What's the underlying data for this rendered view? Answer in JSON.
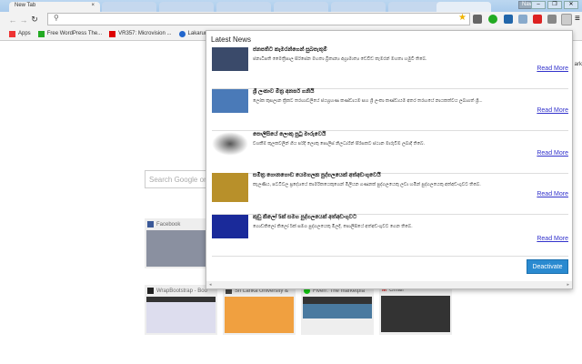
{
  "browser": {
    "active_tab": "New Tab",
    "tab_close": "×",
    "user": "Navodh",
    "win_buttons": [
      "–",
      "❐",
      "✕"
    ],
    "omnibox_value": "",
    "search_icon": "⚲"
  },
  "bookmarks": [
    {
      "label": "Apps",
      "color": "#e33"
    },
    {
      "label": "Free WordPress The...",
      "color": "#2a2"
    },
    {
      "label": "VR357: Microvision ...",
      "color": "#d00"
    },
    {
      "label": "Lakaruna",
      "color": "#26c"
    }
  ],
  "newtab": {
    "search_placeholder": "Search Google or",
    "tiles": [
      {
        "label": "Facebook"
      },
      {
        "label": "WrapBootstrap - Boo"
      },
      {
        "label": "Sri Lanka University &"
      },
      {
        "label": "Fiverr: The marketpla"
      },
      {
        "label": "Gmail"
      }
    ]
  },
  "popup": {
    "heading": "Latest News",
    "read_more": "Read More",
    "deactivate": "Deactivate",
    "partial_right": "ark",
    "items": [
      {
        "title": "ජනපතිට කැමරන්ගෙන් සුබපැතුම්",
        "desc": "ජනාධිපති මෛත්‍රීපාල සිරිසේන මහතා බ්‍රිතාන්‍ය අග්‍රාමාත්‍ය ඩේවිඩ් කැමරන් මහතා හමුවී තිබේ.",
        "color": "#3a4a6a"
      },
      {
        "title": "ශ්‍රී ලංකාව මිත්‍ර අනර්ඝ ගනියි",
        "desc": "ලෝක කුසලාන ක්‍රිකට් තරඟාවලියේ ජයග්‍රහණ කණ්ඩායම සහ ශ්‍රී ලංකා කණ්ඩායම අතර තරඟයේ නායකත්වය ලබාගත් ශ්‍රී...",
        "color": "#4a7ab8"
      },
      {
        "title": "පොලීසියේ ලොකු පුටු මාරුවෙයි",
        "desc": "වගකීම් කුලකවලින් ගිය පරිදි ලොකු පොලිස් නිලධාරීන් පිරිසකට ස්ථාන මාරුවීම් ලබාදී තිබේ.",
        "color": "#333"
      },
      {
        "title": "සමිත්‍ර ගොනගොඩ යෙමගලක පුද්ගලයෙක් අත්අඩංගුවෙයි",
        "desc": "කැලණිය, පට්ටිවල ප්‍රදේශයේ කාර්මිකයෙකුගෙන් මිලියන ගණනක් පුද්ගලයෙකු ලවා හමින් පුද්ගලයෙකු අත්අඩංගුවට තිබේ.",
        "color": "#b8902a"
      },
      {
        "title": "කුඩු කිලෝ 5ක් සමග පුද්ගලයෙක් අත්අඩංගුවට",
        "desc": "ගොඩකිලෝ කිලෝ 5ක් සමග පුද්ගලයෙකු මිලදී, පොලිසියේ අත්අඩංගුවට ගෙන තිබේ.",
        "color": "#1a2a9a"
      }
    ]
  }
}
